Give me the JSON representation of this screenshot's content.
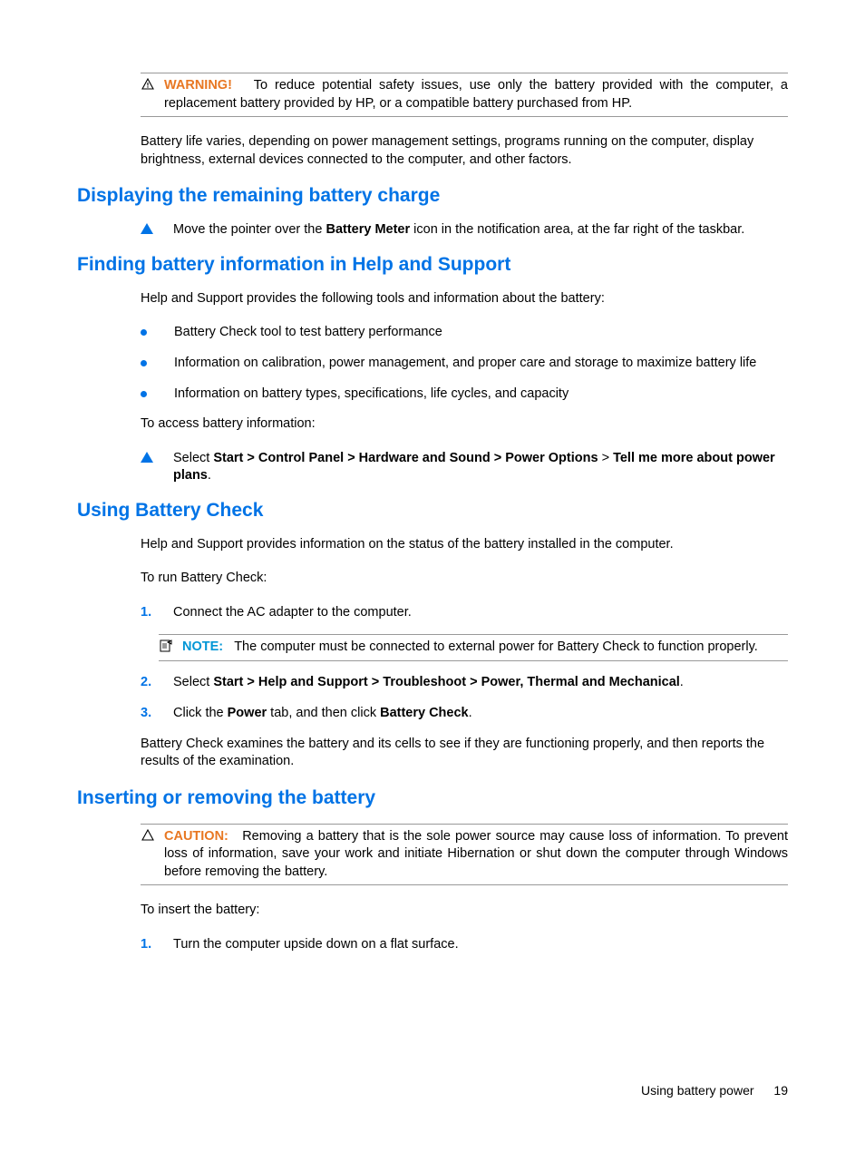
{
  "warning": {
    "label": "WARNING!",
    "text": "To reduce potential safety issues, use only the battery provided with the computer, a replacement battery provided by HP, or a compatible battery purchased from HP."
  },
  "battery_life_para": "Battery life varies, depending on power management settings, programs running on the computer, display brightness, external devices connected to the computer, and other factors.",
  "h_display": "Displaying the remaining battery charge",
  "display_step": {
    "prefix": "Move the pointer over the ",
    "bold": "Battery Meter",
    "suffix": " icon in the notification area, at the far right of the taskbar."
  },
  "h_finding": "Finding battery information in Help and Support",
  "finding_intro": "Help and Support provides the following tools and information about the battery:",
  "finding_bullets": [
    "Battery Check tool to test battery performance",
    "Information on calibration, power management, and proper care and storage to maximize battery life",
    "Information on battery types, specifications, life cycles, and capacity"
  ],
  "access_info": "To access battery information:",
  "access_step": {
    "prefix": "Select ",
    "bold1": "Start > Control Panel > Hardware and Sound > Power Options",
    "mid": " > ",
    "bold2": "Tell me more about power plans",
    "suffix": "."
  },
  "h_using": "Using Battery Check",
  "using_intro": "Help and Support provides information on the status of the battery installed in the computer.",
  "using_run": "To run Battery Check:",
  "ol_1": "Connect the AC adapter to the computer.",
  "note": {
    "label": "NOTE:",
    "text": "The computer must be connected to external power for Battery Check to function properly."
  },
  "ol_2": {
    "prefix": "Select ",
    "bold": "Start > Help and Support  > Troubleshoot > Power, Thermal and Mechanical",
    "suffix": "."
  },
  "ol_3": {
    "p1": "Click the ",
    "b1": "Power",
    "p2": " tab, and then click ",
    "b2": "Battery Check",
    "p3": "."
  },
  "using_result": "Battery Check examines the battery and its cells to see if they are functioning properly, and then reports the results of the examination.",
  "h_insert": "Inserting or removing the battery",
  "caution": {
    "label": "CAUTION:",
    "text": "Removing a battery that is the sole power source may cause loss of information. To prevent loss of information, save your work and initiate Hibernation or shut down the computer through Windows before removing the battery."
  },
  "insert_intro": "To insert the battery:",
  "insert_1": "Turn the computer upside down on a flat surface.",
  "footer_text": "Using battery power",
  "footer_page": "19"
}
